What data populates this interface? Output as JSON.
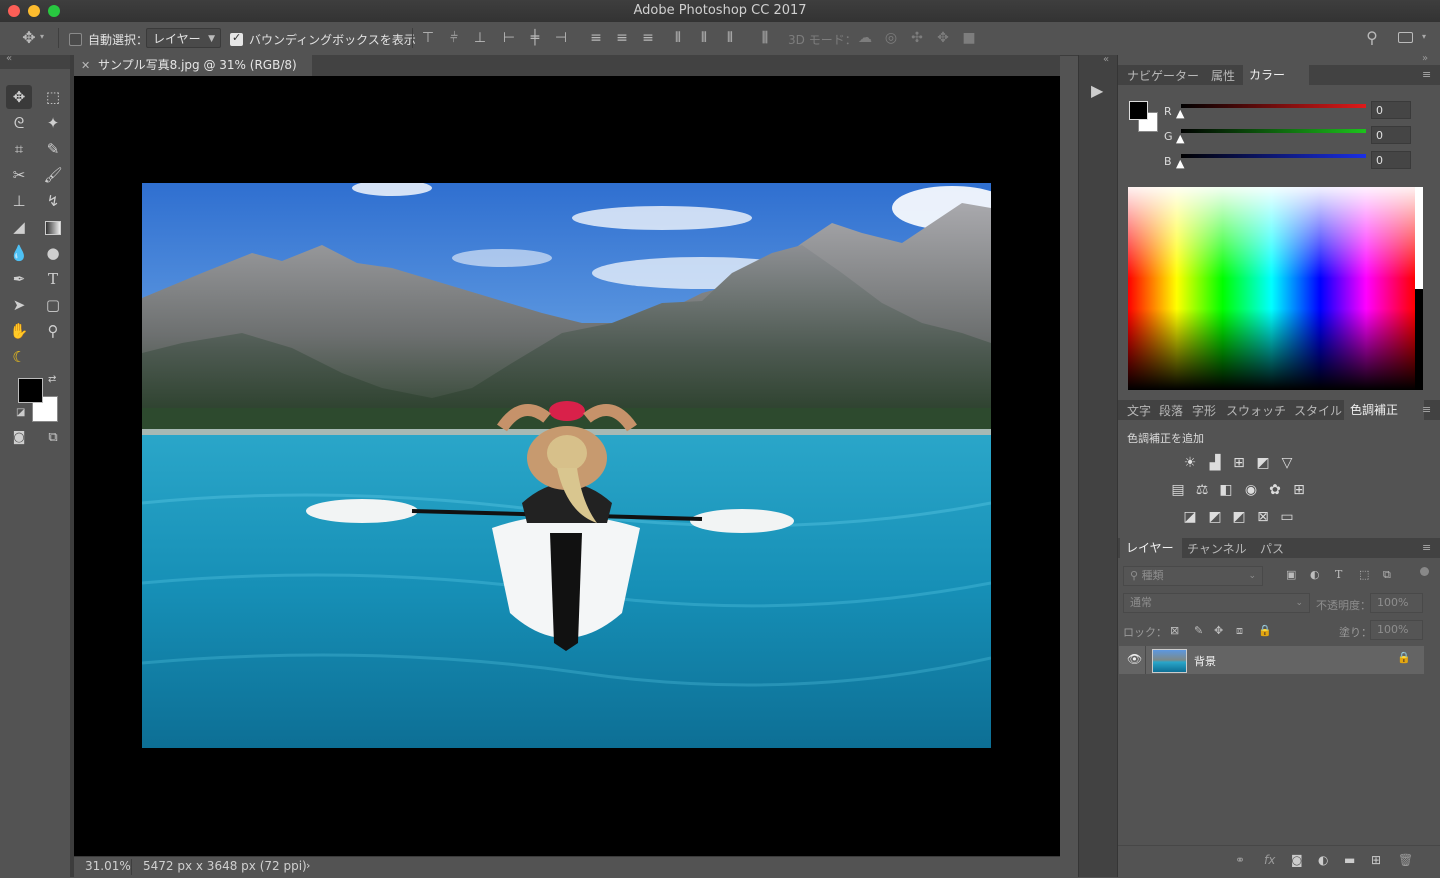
{
  "window": {
    "title": "Adobe Photoshop CC 2017"
  },
  "options_bar": {
    "auto_select_label": "自動選択：",
    "auto_select_value": "レイヤー",
    "bounding_box_label": "バウンディングボックスを表示",
    "mode_3d_label": "3D モード："
  },
  "document": {
    "tab_title": "サンプル写真8.jpg @ 31% (RGB/8)",
    "zoom": "31.01%",
    "info": "5472 px x 3648 px (72 ppi)"
  },
  "color_panel": {
    "tabs": [
      "ナビゲーター",
      "属性",
      "カラー"
    ],
    "active_tab": "カラー",
    "channels": [
      {
        "label": "R",
        "value": "0",
        "color": "#e01a1a"
      },
      {
        "label": "G",
        "value": "0",
        "color": "#1cc31c"
      },
      {
        "label": "B",
        "value": "0",
        "color": "#1a2fe6"
      }
    ]
  },
  "adjustments_panel": {
    "tabs": [
      "文字",
      "段落",
      "字形",
      "スウォッチ",
      "スタイル",
      "色調補正"
    ],
    "active_tab": "色調補正",
    "heading": "色調補正を追加"
  },
  "layers_panel": {
    "tabs": [
      "レイヤー",
      "チャンネル",
      "パス"
    ],
    "active_tab": "レイヤー",
    "filter_placeholder": "種類",
    "blend_mode": "通常",
    "opacity_label": "不透明度：",
    "opacity_value": "100%",
    "lock_label": "ロック：",
    "fill_label": "塗り：",
    "fill_value": "100%",
    "layers": [
      {
        "name": "背景",
        "visible": true,
        "locked": true
      }
    ]
  },
  "colors": {
    "foreground": "#000000",
    "background": "#ffffff",
    "accent": "#0f93c0"
  }
}
